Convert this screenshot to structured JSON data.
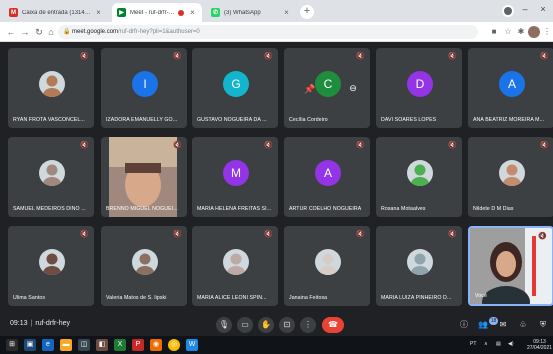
{
  "browser": {
    "tabs": [
      {
        "title": "Caixa de entrada (13144) - daniel",
        "active": false,
        "favicon": "gmail-icon",
        "favicon_color": "#d93025",
        "favicon_glyph": "M"
      },
      {
        "title": "Meet - ruf-drfr-hey",
        "active": true,
        "favicon": "meet-icon",
        "favicon_color": "#00832d",
        "favicon_glyph": "▶"
      },
      {
        "title": "(3) WhatsApp",
        "active": false,
        "favicon": "whatsapp-icon",
        "favicon_color": "#25d366",
        "favicon_glyph": "✆"
      }
    ],
    "new_tab_label": "+",
    "address": {
      "host": "meet.google.com",
      "path": "/ruf-drfr-hey?pli=1&authuser=0"
    }
  },
  "tiles": [
    {
      "name": "RYAN FROTA VASCONCEL...",
      "kind": "photo",
      "photo_color": "#b27b55"
    },
    {
      "name": "IZADORA EMANUELLY GO...",
      "kind": "initial",
      "initial": "I",
      "color": "#1a73e8"
    },
    {
      "name": "GUSTAVO NOGUEIRA DA ...",
      "kind": "initial",
      "initial": "G",
      "color": "#12b5cb"
    },
    {
      "name": "Cecília Cordeiro",
      "kind": "initial-controls",
      "initial": "C",
      "color": "#1e8e3e"
    },
    {
      "name": "DAVI SOARES LOPES",
      "kind": "initial",
      "initial": "D",
      "color": "#9334e6"
    },
    {
      "name": "ANA BEATRIZ MOREIRA M...",
      "kind": "initial",
      "initial": "A",
      "color": "#1a73e8"
    },
    {
      "name": "SAMUEL MEDEIROS DINO ...",
      "kind": "photo",
      "photo_color": "#a1887f"
    },
    {
      "name": "BRENNO MIGUEL NOGUEI...",
      "kind": "video"
    },
    {
      "name": "MARIA HELENA FREITAS SI...",
      "kind": "initial",
      "initial": "M",
      "color": "#9334e6"
    },
    {
      "name": "ARTUR COELHO NOGUEIRA",
      "kind": "initial",
      "initial": "A",
      "color": "#9334e6"
    },
    {
      "name": "Rosana Motaalves",
      "kind": "photo",
      "photo_color": "#4caf50"
    },
    {
      "name": "Nildete D M Dias",
      "kind": "photo",
      "photo_color": "#c48b6e"
    },
    {
      "name": "Ulima Santos",
      "kind": "photo",
      "photo_color": "#6d4c41"
    },
    {
      "name": "Valeria Matos de S. lipski",
      "kind": "photo",
      "photo_color": "#8d6e63"
    },
    {
      "name": "MARIA ALICE LEONI SPIN...",
      "kind": "photo",
      "photo_color": "#bcaaa4"
    },
    {
      "name": "Janaina Feitosa",
      "kind": "photo",
      "photo_color": "#d7ccc8"
    },
    {
      "name": "MARIA LUIZA PINHEIRO D...",
      "kind": "photo",
      "photo_color": "#90a4ae"
    },
    {
      "name": "Você",
      "kind": "self"
    }
  ],
  "bottom": {
    "time": "09:13",
    "meeting_code": "ruf-drfr-hey",
    "participants_badge": "18"
  },
  "taskbar": {
    "clock_time": "09:13",
    "clock_date": "27/04/2021",
    "lang": "PT"
  },
  "colors": {
    "meet_bg": "#202124",
    "tile_bg": "#3c4043",
    "end_call": "#ea4335",
    "accent": "#8ab4f8"
  }
}
